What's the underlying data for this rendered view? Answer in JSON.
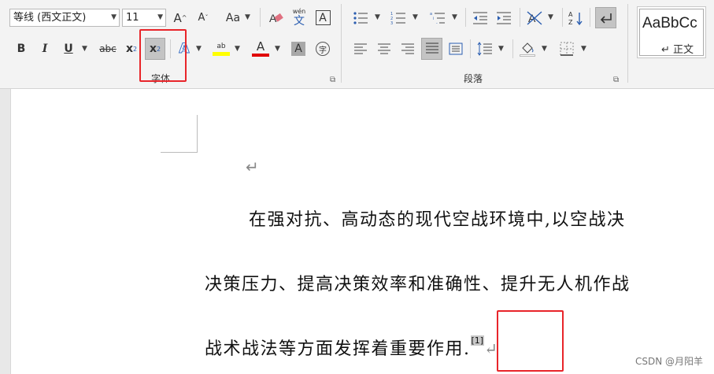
{
  "font_group": {
    "label": "字体",
    "font_name": "等线 (西文正文)",
    "font_size": "11",
    "grow_font": "A",
    "shrink_font": "A",
    "change_case": "Aa",
    "phonetic_top": "wén",
    "phonetic_bottom": "文",
    "char_border": "A",
    "bold": "B",
    "italic": "I",
    "underline": "U",
    "strikethrough": "abc",
    "subscript": "x",
    "subscript_mark": "2",
    "superscript": "x",
    "superscript_mark": "2",
    "text_effects": "A",
    "highlight": "ab",
    "font_color": "A",
    "char_shading": "A",
    "enclose": "字"
  },
  "para_group": {
    "label": "段落"
  },
  "styles": {
    "sample": "AaBbCc",
    "name": "↵ 正文"
  },
  "document": {
    "empty_mark": "↵",
    "line1": "在强对抗、高动态的现代空战环境中,以空战决",
    "line2": "决策压力、提高决策效率和准确性、提升无人机作战",
    "line3": "战术战法等方面发挥着重要作用.",
    "citation": "[1]",
    "end_mark": "↵"
  },
  "colors": {
    "highlight_box": "#e8252a",
    "font_color_bar": "#e00000",
    "highlight_bar": "#ffff00"
  },
  "watermark": "CSDN @月阳羊"
}
